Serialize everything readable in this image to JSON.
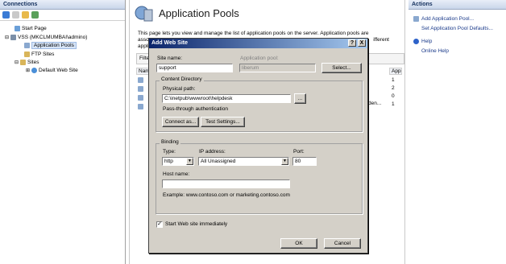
{
  "connections": {
    "title": "Connections",
    "tree": {
      "start_page": "Start Page",
      "server": "VSS (MKCLMUMBAI\\admino)",
      "app_pools": "Application Pools",
      "ftp_sites": "FTP Sites",
      "sites": "Sites",
      "default_site": "Default Web Site"
    }
  },
  "center": {
    "title": "Application Pools",
    "description_lines": [
      "This page lets you view and manage the list of application pools on the server. Application pools are",
      "asso",
      "appli"
    ],
    "desc_tail": "ifferent",
    "filter_label": "Filte",
    "name_col": "Nam",
    "app_col": "App",
    "app_values": [
      "1",
      "2",
      "0",
      "1"
    ],
    "row_tail": "den..."
  },
  "actions": {
    "title": "Actions",
    "add_pool": "Add Application Pool...",
    "set_defaults": "Set Application Pool Defaults...",
    "help": "Help",
    "online_help": "Online Help"
  },
  "dialog": {
    "title": "Add Web Site",
    "help_btn": "?",
    "close_btn": "X",
    "site_name_label": "Site name:",
    "site_name": "support",
    "app_pool_label": "Application pool:",
    "app_pool": "liberum",
    "select_btn": "Select...",
    "content_dir_label": "Content Directory",
    "physical_path_label": "Physical path:",
    "physical_path": "C:\\inetpub\\wwwroot\\helpdesk",
    "browse_btn": "...",
    "passthrough_label": "Pass-through authentication",
    "connect_btn": "Connect as...",
    "test_btn": "Test Settings...",
    "binding_label": "Binding",
    "type_label": "Type:",
    "type_value": "http",
    "ip_label": "IP address:",
    "ip_value": "All Unassigned",
    "port_label": "Port:",
    "port_value": "80",
    "host_label": "Host name:",
    "host_value": "",
    "example": "Example: www.contoso.com or marketing.contoso.com",
    "start_label": "Start Web site immediately",
    "start_checked": "✓",
    "ok_btn": "OK",
    "cancel_btn": "Cancel"
  }
}
